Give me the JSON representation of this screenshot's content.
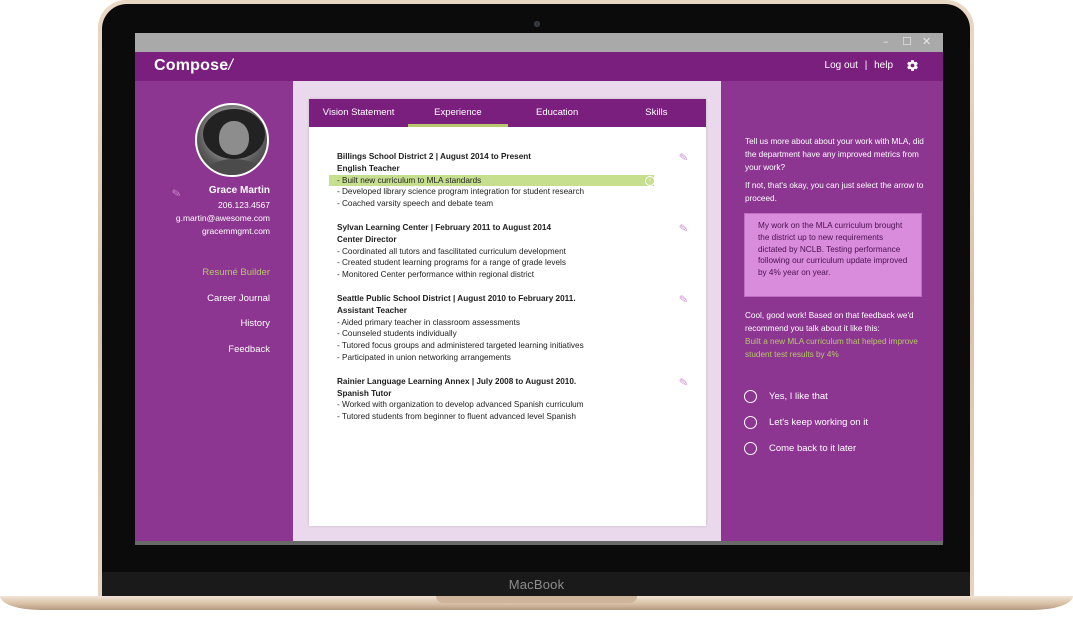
{
  "device": {
    "brand": "MacBook"
  },
  "window": {
    "controls": {
      "minimize": "–",
      "maximize": "☐",
      "close": "✕"
    }
  },
  "app": {
    "logo": "Compose",
    "logo_slash": "/",
    "logout": "Log out",
    "separator": "|",
    "help": "help",
    "settings_icon": "gear-icon"
  },
  "profile": {
    "name": "Grace Martin",
    "phone": "206.123.4567",
    "email": "g.martin@awesome.com",
    "website": "gracemmgmt.com"
  },
  "nav": {
    "items": [
      {
        "label": "Resumé Builder",
        "active": true
      },
      {
        "label": "Career Journal",
        "active": false
      },
      {
        "label": "History",
        "active": false
      },
      {
        "label": "Feedback",
        "active": false
      }
    ]
  },
  "tabs": [
    {
      "label": "Vision Statement",
      "active": false
    },
    {
      "label": "Experience",
      "active": true
    },
    {
      "label": "Education",
      "active": false
    },
    {
      "label": "Skills",
      "active": false
    }
  ],
  "experience": [
    {
      "title": "Billings School District 2 | August 2014 to Present",
      "role": "English Teacher",
      "bullets": [
        "- Built new curriculum to MLA standards",
        "- Developed library science program integration for student research",
        "- Coached varsity speech and debate team"
      ]
    },
    {
      "title": "Sylvan Learning Center | February 2011 to August 2014",
      "role": "Center Director",
      "bullets": [
        "- Coordinated all tutors and fascilitated curriculum development",
        "- Created student learning programs for a range of grade levels",
        "- Monitored Center performance within regional district"
      ]
    },
    {
      "title": "Seattle Public School District | August 2010 to February 2011.",
      "role": "Assistant Teacher",
      "bullets": [
        "- Aided primary teacher in classroom assessments",
        "- Counseled students individually",
        "- Tutored focus groups and administered targeted learning initiatives",
        "- Participated in union networking arrangements"
      ]
    },
    {
      "title": "Rainier Language Learning Annex | July 2008 to August 2010.",
      "role": "Spanish Tutor",
      "bullets": [
        "- Worked with organization to develop advanced Spanish curriculum",
        "- Tutored students from beginner to fluent advanced level Spanish"
      ]
    }
  ],
  "assistant": {
    "question": "Tell us more about about your work with MLA, did the department have any improved metrics from your work?",
    "hint": "If not, that's okay, you can just select the arrow to proceed.",
    "response": "My work on the MLA curriculum brought the district up to new requirements dictated by NCLB. Testing performance following our curriculum update improved by 4% year on year.",
    "feedback": "Cool, good work! Based on that feedback we'd recommend you talk about it like this:",
    "suggestion": "Built a new MLA curriculum that helped improve student test results by 4%",
    "options": [
      "Yes, I like that",
      "Let's keep working on it",
      "Come back to it later"
    ]
  },
  "colors": {
    "brand_purple": "#7b1f7f",
    "panel_purple": "#8c3591",
    "accent_green": "#b5c86b",
    "highlight_green": "#c6df8e",
    "response_pink": "#d98bdc"
  }
}
